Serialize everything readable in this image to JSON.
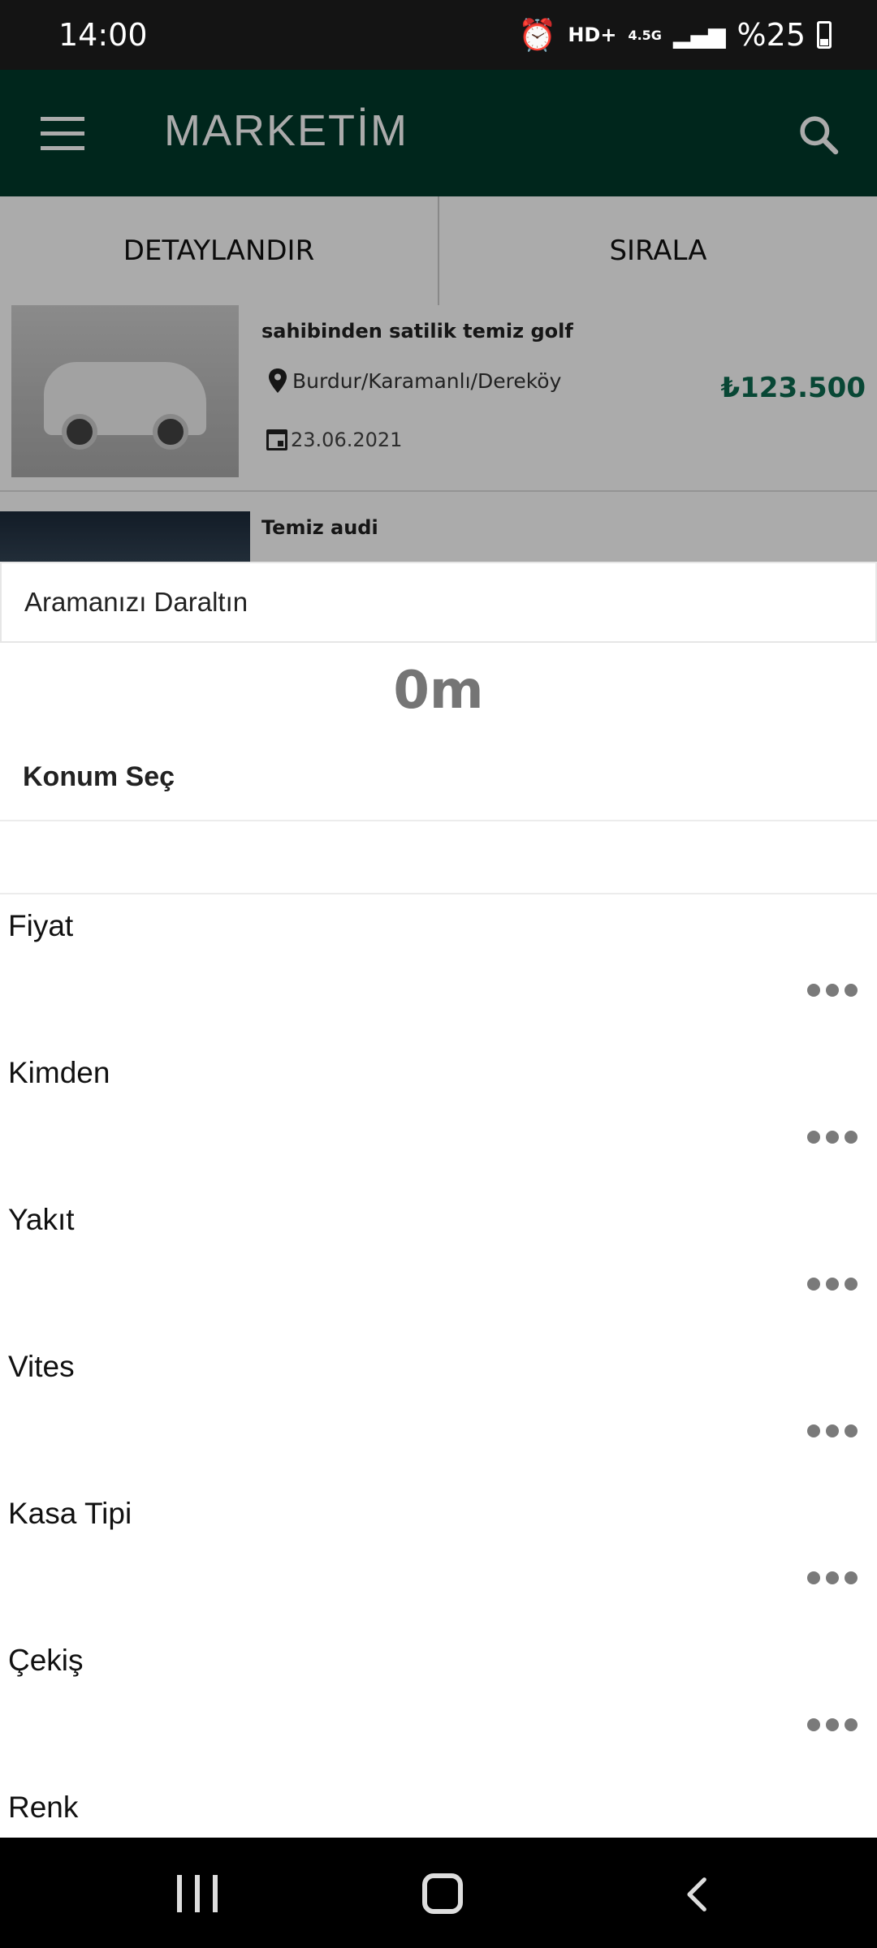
{
  "status_bar": {
    "time": "14:00",
    "network": "HD+",
    "network_gen": "4.5G",
    "battery": "%25"
  },
  "app_bar": {
    "title": "MARKETİM"
  },
  "tabs": {
    "detail": "DETAYLANDIR",
    "sort": "SIRALA"
  },
  "listings": [
    {
      "title": "sahibinden satilik temiz golf",
      "location": "Burdur/Karamanlı/Dereköy",
      "date": "23.06.2021",
      "price": "₺123.500"
    },
    {
      "title": "Temiz audi"
    }
  ],
  "sheet": {
    "header": "Aramanızı Daraltın",
    "distance": "0m",
    "location_label": "Konum Seç",
    "filters": [
      "Fiyat",
      "Kimden",
      "Yakıt",
      "Vites",
      "Kasa Tipi",
      "Çekiş",
      "Renk"
    ]
  },
  "colors": {
    "app_bar": "#003a2b",
    "price": "#0d6b4f"
  }
}
